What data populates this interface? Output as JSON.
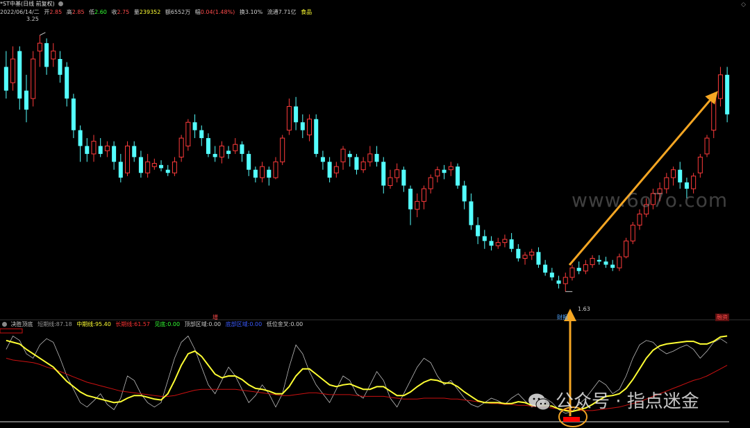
{
  "header": {
    "name": "*ST中基(日线 前复权)",
    "date": "2022/06/14/二",
    "open_label": "开",
    "open": "2.85",
    "high_label": "高",
    "high": "2.85",
    "low_label": "低",
    "low": "2.60",
    "close_label": "收",
    "close": "2.75",
    "vol_label": "量",
    "vol": "239352",
    "amount_label": "额",
    "amount": "6552万",
    "change_label": "幅",
    "change": "0.04(1.48%)",
    "turnover_label": "换",
    "turnover": "3.10%",
    "float_label": "流通",
    "float": "7.71亿",
    "sector": "食品"
  },
  "price_labels": {
    "high_mark": "3.25",
    "low_mark": "1.63"
  },
  "event_tags": {
    "e1": "增",
    "e2": "财报",
    "e3": "融资"
  },
  "sub_header": {
    "name": "决胜顶底",
    "short_label": "短期线:",
    "short": "87.18",
    "mid_label": "中期线:",
    "mid": "95.40",
    "long_label": "长期线:",
    "long": "61.57",
    "bottom_label": "见底:",
    "bottom": "0.00",
    "top_zone_label": "顶部区域:",
    "top_zone": "0.00",
    "bottom_zone_label": "底部区域:",
    "bottom_zone": "0.00",
    "golden_cross_label": "低位金叉:",
    "golden_cross": "0.00"
  },
  "watermarks": {
    "site": "www.6o7o.com",
    "wechat": "公众号 · 指点迷金"
  },
  "colors": {
    "up": "#ff3b3b",
    "down": "#54ffff",
    "mid_line": "#ffff33",
    "long_line": "#cc1111",
    "short_line": "#bbbbbb",
    "arrow": "#f5a623"
  },
  "chart_data": {
    "type": "candlestick",
    "ylim": [
      1.5,
      3.35
    ],
    "candles": [
      [
        3.05,
        2.9,
        3.15,
        2.85
      ],
      [
        2.95,
        3.1,
        3.18,
        2.9
      ],
      [
        3.15,
        2.85,
        3.18,
        2.78
      ],
      [
        2.9,
        2.78,
        3.0,
        2.7
      ],
      [
        2.85,
        3.1,
        3.15,
        2.8
      ],
      [
        3.15,
        3.2,
        3.25,
        3.05
      ],
      [
        3.2,
        3.05,
        3.23,
        3.0
      ],
      [
        3.1,
        3.15,
        3.2,
        3.05
      ],
      [
        3.1,
        3.0,
        3.15,
        2.95
      ],
      [
        3.05,
        2.85,
        3.08,
        2.8
      ],
      [
        2.85,
        2.65,
        2.88,
        2.6
      ],
      [
        2.65,
        2.55,
        2.68,
        2.45
      ],
      [
        2.55,
        2.5,
        2.6,
        2.45
      ],
      [
        2.5,
        2.58,
        2.62,
        2.45
      ],
      [
        2.55,
        2.5,
        2.6,
        2.48
      ],
      [
        2.52,
        2.55,
        2.58,
        2.48
      ],
      [
        2.55,
        2.45,
        2.58,
        2.4
      ],
      [
        2.45,
        2.35,
        2.5,
        2.32
      ],
      [
        2.38,
        2.55,
        2.58,
        2.36
      ],
      [
        2.55,
        2.48,
        2.58,
        2.45
      ],
      [
        2.48,
        2.38,
        2.52,
        2.35
      ],
      [
        2.38,
        2.45,
        2.5,
        2.35
      ],
      [
        2.42,
        2.44,
        2.47,
        2.4
      ],
      [
        2.43,
        2.41,
        2.46,
        2.39
      ],
      [
        2.4,
        2.38,
        2.43,
        2.36
      ],
      [
        2.38,
        2.45,
        2.48,
        2.36
      ],
      [
        2.48,
        2.6,
        2.62,
        2.45
      ],
      [
        2.55,
        2.7,
        2.72,
        2.52
      ],
      [
        2.7,
        2.65,
        2.75,
        2.6
      ],
      [
        2.65,
        2.6,
        2.68,
        2.55
      ],
      [
        2.6,
        2.5,
        2.63,
        2.48
      ],
      [
        2.5,
        2.48,
        2.55,
        2.45
      ],
      [
        2.48,
        2.55,
        2.58,
        2.44
      ],
      [
        2.52,
        2.5,
        2.55,
        2.47
      ],
      [
        2.52,
        2.56,
        2.6,
        2.5
      ],
      [
        2.56,
        2.5,
        2.58,
        2.45
      ],
      [
        2.5,
        2.4,
        2.52,
        2.36
      ],
      [
        2.4,
        2.35,
        2.42,
        2.32
      ],
      [
        2.35,
        2.42,
        2.45,
        2.32
      ],
      [
        2.4,
        2.35,
        2.42,
        2.3
      ],
      [
        2.35,
        2.45,
        2.48,
        2.34
      ],
      [
        2.45,
        2.6,
        2.62,
        2.43
      ],
      [
        2.65,
        2.8,
        2.85,
        2.62
      ],
      [
        2.8,
        2.7,
        2.86,
        2.65
      ],
      [
        2.7,
        2.65,
        2.75,
        2.6
      ],
      [
        2.62,
        2.72,
        2.75,
        2.58
      ],
      [
        2.72,
        2.5,
        2.75,
        2.48
      ],
      [
        2.48,
        2.45,
        2.52,
        2.4
      ],
      [
        2.45,
        2.35,
        2.48,
        2.32
      ],
      [
        2.38,
        2.42,
        2.45,
        2.35
      ],
      [
        2.45,
        2.53,
        2.55,
        2.4
      ],
      [
        2.5,
        2.48,
        2.52,
        2.42
      ],
      [
        2.48,
        2.4,
        2.5,
        2.37
      ],
      [
        2.4,
        2.45,
        2.48,
        2.38
      ],
      [
        2.45,
        2.5,
        2.55,
        2.42
      ],
      [
        2.5,
        2.45,
        2.55,
        2.42
      ],
      [
        2.45,
        2.3,
        2.48,
        2.25
      ],
      [
        2.3,
        2.35,
        2.4,
        2.28
      ],
      [
        2.35,
        2.4,
        2.44,
        2.32
      ],
      [
        2.4,
        2.3,
        2.42,
        2.26
      ],
      [
        2.28,
        2.15,
        2.3,
        2.05
      ],
      [
        2.15,
        2.2,
        2.25,
        2.1
      ],
      [
        2.2,
        2.28,
        2.3,
        2.15
      ],
      [
        2.28,
        2.35,
        2.37,
        2.25
      ],
      [
        2.36,
        2.4,
        2.42,
        2.32
      ],
      [
        2.4,
        2.38,
        2.43,
        2.34
      ],
      [
        2.4,
        2.42,
        2.45,
        2.36
      ],
      [
        2.42,
        2.3,
        2.44,
        2.28
      ],
      [
        2.3,
        2.2,
        2.33,
        2.15
      ],
      [
        2.2,
        2.05,
        2.25,
        2.02
      ],
      [
        2.05,
        1.98,
        2.1,
        1.93
      ],
      [
        1.98,
        1.95,
        2.02,
        1.9
      ],
      [
        1.95,
        1.92,
        1.98,
        1.89
      ],
      [
        1.92,
        1.94,
        1.97,
        1.9
      ],
      [
        1.94,
        1.96,
        1.99,
        1.91
      ],
      [
        1.96,
        1.9,
        2.0,
        1.88
      ],
      [
        1.9,
        1.84,
        1.93,
        1.82
      ],
      [
        1.84,
        1.86,
        1.88,
        1.8
      ],
      [
        1.86,
        1.88,
        1.9,
        1.83
      ],
      [
        1.88,
        1.8,
        1.91,
        1.78
      ],
      [
        1.8,
        1.75,
        1.83,
        1.73
      ],
      [
        1.75,
        1.72,
        1.78,
        1.7
      ],
      [
        1.7,
        1.68,
        1.73,
        1.65
      ],
      [
        1.68,
        1.72,
        1.75,
        1.63
      ],
      [
        1.72,
        1.78,
        1.8,
        1.7
      ],
      [
        1.78,
        1.76,
        1.82,
        1.74
      ],
      [
        1.76,
        1.8,
        1.83,
        1.74
      ],
      [
        1.8,
        1.84,
        1.86,
        1.78
      ],
      [
        1.83,
        1.82,
        1.86,
        1.8
      ],
      [
        1.82,
        1.8,
        1.85,
        1.78
      ],
      [
        1.8,
        1.78,
        1.83,
        1.76
      ],
      [
        1.78,
        1.85,
        1.87,
        1.76
      ],
      [
        1.85,
        1.95,
        1.97,
        1.84
      ],
      [
        1.95,
        2.05,
        2.07,
        1.93
      ],
      [
        2.05,
        2.12,
        2.15,
        2.02
      ],
      [
        2.12,
        2.18,
        2.22,
        2.1
      ],
      [
        2.18,
        2.25,
        2.28,
        2.15
      ],
      [
        2.25,
        2.28,
        2.32,
        2.2
      ],
      [
        2.28,
        2.35,
        2.38,
        2.25
      ],
      [
        2.35,
        2.4,
        2.42,
        2.3
      ],
      [
        2.4,
        2.32,
        2.45,
        2.28
      ],
      [
        2.32,
        2.28,
        2.35,
        2.22
      ],
      [
        2.28,
        2.36,
        2.38,
        2.25
      ],
      [
        2.38,
        2.48,
        2.5,
        2.35
      ],
      [
        2.5,
        2.6,
        2.62,
        2.48
      ],
      [
        2.65,
        2.85,
        2.88,
        2.6
      ],
      [
        2.85,
        3.0,
        3.05,
        2.8
      ],
      [
        3.0,
        2.75,
        3.05,
        2.7
      ]
    ],
    "indicator": {
      "name": "决胜顶底",
      "short": [
        80,
        95,
        90,
        75,
        70,
        85,
        92,
        88,
        70,
        50,
        35,
        20,
        15,
        22,
        30,
        18,
        12,
        25,
        50,
        45,
        30,
        20,
        15,
        20,
        45,
        70,
        88,
        95,
        80,
        60,
        40,
        30,
        45,
        60,
        50,
        35,
        20,
        28,
        40,
        30,
        15,
        30,
        60,
        85,
        75,
        55,
        40,
        30,
        20,
        35,
        50,
        45,
        30,
        25,
        40,
        55,
        45,
        25,
        15,
        30,
        45,
        60,
        70,
        65,
        50,
        40,
        45,
        35,
        25,
        18,
        15,
        20,
        25,
        22,
        18,
        25,
        30,
        22,
        15,
        18,
        25,
        20,
        12,
        8,
        10,
        18,
        25,
        35,
        45,
        40,
        30,
        35,
        50,
        70,
        85,
        90,
        88,
        80,
        75,
        78,
        82,
        85,
        80,
        70,
        78,
        88,
        92,
        87
      ],
      "mid": [
        90,
        88,
        86,
        80,
        75,
        70,
        65,
        60,
        52,
        44,
        38,
        32,
        28,
        26,
        24,
        22,
        20,
        21,
        25,
        28,
        28,
        26,
        24,
        23,
        30,
        45,
        62,
        75,
        78,
        72,
        62,
        52,
        48,
        50,
        50,
        46,
        40,
        36,
        35,
        33,
        30,
        30,
        38,
        50,
        58,
        58,
        52,
        46,
        40,
        38,
        40,
        41,
        38,
        35,
        35,
        38,
        38,
        33,
        28,
        28,
        32,
        38,
        43,
        46,
        45,
        42,
        42,
        38,
        32,
        27,
        22,
        20,
        20,
        20,
        19,
        19,
        21,
        20,
        17,
        16,
        17,
        16,
        13,
        11,
        10,
        12,
        14,
        18,
        23,
        27,
        28,
        30,
        36,
        46,
        58,
        70,
        79,
        84,
        86,
        87,
        88,
        89,
        89,
        86,
        86,
        89,
        94,
        95
      ],
      "long": [
        70,
        68,
        67,
        66,
        65,
        63,
        60,
        58,
        55,
        52,
        49,
        46,
        43,
        41,
        39,
        37,
        35,
        33,
        32,
        31,
        30,
        29,
        28,
        27,
        27,
        28,
        30,
        32,
        34,
        35,
        35,
        35,
        35,
        35,
        35,
        34,
        33,
        32,
        31,
        30,
        29,
        28,
        28,
        29,
        30,
        31,
        31,
        30,
        29,
        29,
        29,
        29,
        28,
        27,
        27,
        27,
        27,
        26,
        25,
        24,
        24,
        24,
        25,
        25,
        25,
        25,
        24,
        24,
        23,
        22,
        21,
        20,
        19,
        19,
        18,
        18,
        17,
        17,
        16,
        15,
        15,
        14,
        13,
        12,
        11,
        11,
        11,
        11,
        12,
        13,
        14,
        15,
        17,
        19,
        21,
        24,
        27,
        30,
        33,
        36,
        39,
        42,
        45,
        47,
        50,
        54,
        58,
        62
      ],
      "ylim": [
        0,
        100
      ]
    }
  }
}
